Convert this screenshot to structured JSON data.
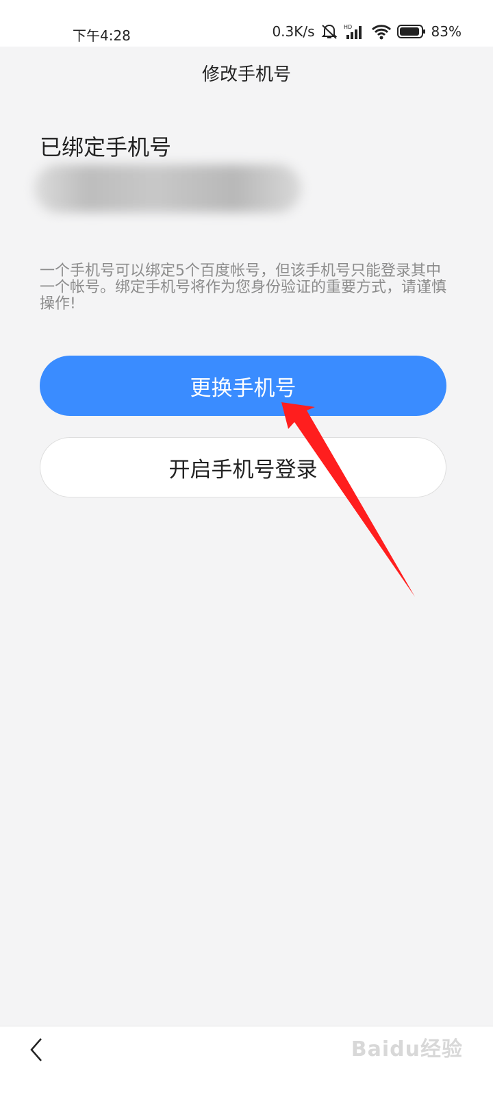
{
  "status_bar": {
    "time": "下午4:28",
    "network_speed": "0.3K/s",
    "battery_percent": "83%",
    "icons": [
      "mute-icon",
      "hd-signal-icon",
      "wifi-icon",
      "battery-icon"
    ]
  },
  "header": {
    "title": "修改手机号"
  },
  "content": {
    "bound_label": "已绑定手机号",
    "notice": "一个手机号可以绑定5个百度帐号，但该手机号只能登录其中一个帐号。绑定手机号将作为您身份验证的重要方式，请谨慎操作!"
  },
  "actions": {
    "change_phone": "更换手机号",
    "enable_phone_login": "开启手机号登录"
  },
  "bottom": {
    "back_icon": "chevron-left-icon",
    "watermark": "Baidu经验"
  },
  "colors": {
    "primary": "#3a8cff",
    "background": "#f4f4f5",
    "annotation": "#ff1e1e"
  }
}
